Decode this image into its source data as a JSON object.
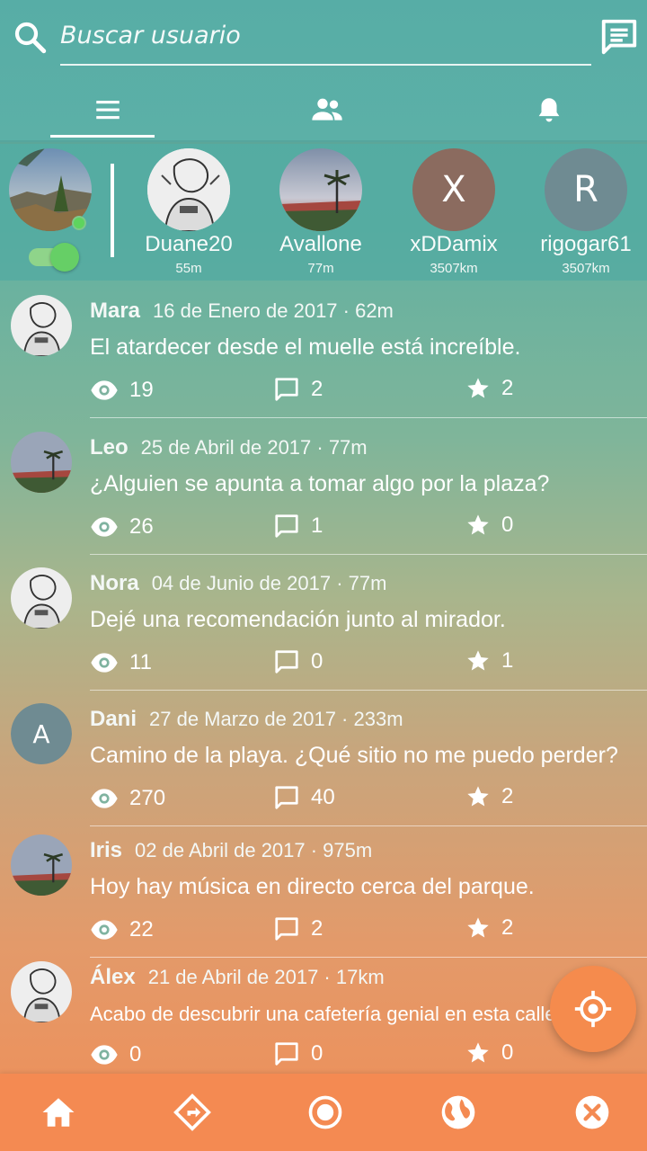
{
  "search": {
    "placeholder": "Buscar usuario"
  },
  "tabs": [
    {
      "icon": "menu-icon",
      "active": true
    },
    {
      "icon": "people-icon",
      "active": false
    },
    {
      "icon": "bell-icon",
      "active": false
    }
  ],
  "stories": [
    {
      "name": "Duane20",
      "distance": "55m",
      "avatar": "sketch"
    },
    {
      "name": "Avallone",
      "distance": "77m",
      "avatar": "palm"
    },
    {
      "name": "xDDamix",
      "distance": "3507km",
      "avatar": "letter",
      "letter": "X",
      "color": "#8b6b5f"
    },
    {
      "name": "rigogar61",
      "distance": "3507km",
      "avatar": "letter",
      "letter": "R",
      "color": "#6f8b92"
    }
  ],
  "posts": [
    {
      "user": "Mara",
      "meta": "16 de Enero de 2017 · 62m",
      "text": "El atardecer desde el muelle está increíble.",
      "views": "19",
      "comments": "2",
      "stars": "2",
      "avatar": "sketch"
    },
    {
      "user": "Leo",
      "meta": "25 de Abril de 2017 · 77m",
      "text": "¿Alguien se apunta a tomar algo por la plaza?",
      "views": "26",
      "comments": "1",
      "stars": "0",
      "avatar": "palm"
    },
    {
      "user": "Nora",
      "meta": "04 de Junio de 2017 · 77m",
      "text": "Dejé una recomendación junto al mirador.",
      "views": "11",
      "comments": "0",
      "stars": "1",
      "avatar": "sketch"
    },
    {
      "user": "Dani",
      "meta": "27 de Marzo de 2017 · 233m",
      "text": "Camino de la playa. ¿Qué sitio no me puedo perder?",
      "views": "270",
      "comments": "40",
      "stars": "2",
      "avatar": "letter",
      "letter": "A"
    },
    {
      "user": "Iris",
      "meta": "02 de Abril de 2017 · 975m",
      "text": "Hoy hay música en directo cerca del parque.",
      "views": "22",
      "comments": "2",
      "stars": "2",
      "avatar": "palm"
    },
    {
      "user": "Álex",
      "meta": "21 de Abril de 2017 · 17km",
      "text": "Acabo de descubrir una cafetería genial en esta calle.",
      "views": "0",
      "comments": "0",
      "stars": "0",
      "avatar": "sketch"
    }
  ],
  "bottom_nav": [
    "home-icon",
    "directions-icon",
    "record-icon",
    "globe-icon",
    "close-circle-icon"
  ],
  "colors": {
    "accent": "#f48a52",
    "header": "#57ada6",
    "toggle_on": "#66cf66"
  }
}
